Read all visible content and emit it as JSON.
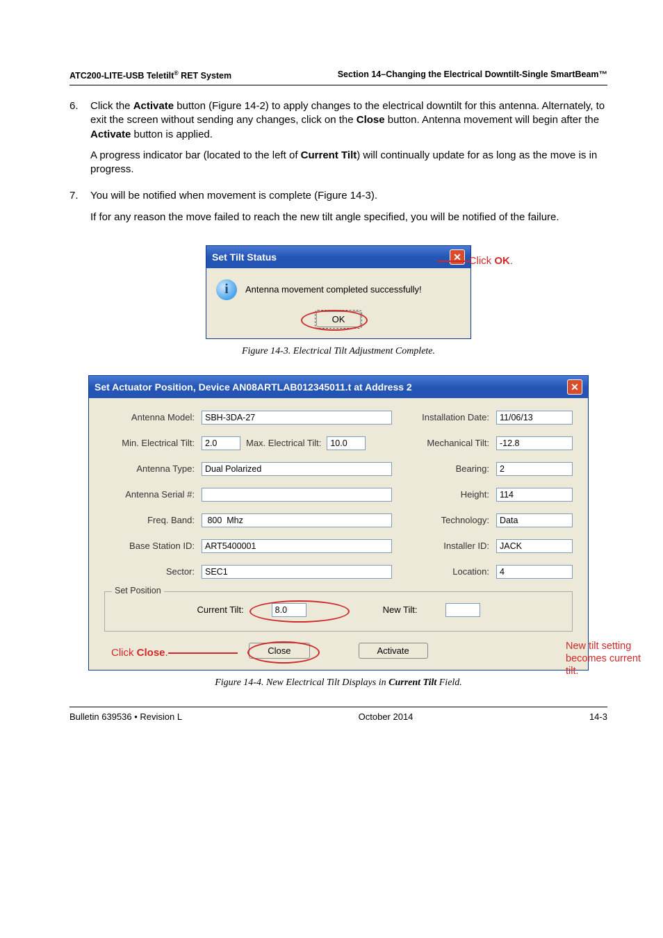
{
  "header": {
    "left": "ATC200-LITE-USB Teletilt® RET System",
    "right": "Section 14–Changing the Electrical Downtilt-Single SmartBeam™"
  },
  "steps": {
    "s6": {
      "num": "6.",
      "p1a": "Click the ",
      "p1b": "Activate",
      "p1c": " button (Figure 14-2) to apply changes to the electrical downtilt for this antenna. Alternately, to exit the screen without sending any changes, click on the ",
      "p1d": "Close",
      "p1e": " button. Antenna movement will begin after the ",
      "p1f": "Activate",
      "p1g": " button is applied.",
      "p2a": "A progress indicator bar (located to the left of ",
      "p2b": "Current Tilt",
      "p2c": ") will continually update for as long as the move is in progress."
    },
    "s7": {
      "num": "7.",
      "p1": "You will be notified when movement is complete (Figure 14-3).",
      "p2": "If for any reason the move failed to reach the new tilt angle specified, you will be notified of the failure."
    }
  },
  "dlg1": {
    "title": "Set Tilt Status",
    "msg": "Antenna movement completed successfully!",
    "ok": "OK",
    "click_ok_a": "Click ",
    "click_ok_b": "OK",
    "click_ok_c": "."
  },
  "caption1": "Figure 14-3. Electrical Tilt Adjustment Complete.",
  "dlg2": {
    "title": "Set Actuator Position, Device AN08ARTLAB012345011.t  at Address 2",
    "labels": {
      "model": "Antenna Model:",
      "install": "Installation Date:",
      "mintilt": "Min. Electrical Tilt:",
      "maxtilt": "Max. Electrical Tilt:",
      "mech": "Mechanical Tilt:",
      "type": "Antenna Type:",
      "bearing": "Bearing:",
      "serial": "Antenna Serial #:",
      "height": "Height:",
      "band": "Freq. Band:",
      "tech": "Technology:",
      "bsid": "Base Station ID:",
      "installer": "Installer ID:",
      "sector": "Sector:",
      "location": "Location:"
    },
    "vals": {
      "model": "SBH-3DA-27",
      "install": "11/06/13",
      "mintilt": "2.0",
      "maxtilt": "10.0",
      "mech": "-12.8",
      "type": "Dual Polarized",
      "bearing": "2",
      "serial": "",
      "height": "114",
      "band": " 800  Mhz",
      "tech": "Data",
      "bsid": "ART5400001",
      "installer": "JACK",
      "sector": "SEC1",
      "location": "4"
    },
    "legend": "Set Position",
    "curr_lbl": "Current Tilt:",
    "curr_val": "8.0",
    "new_lbl": "New Tilt:",
    "new_val": "",
    "close": "Close",
    "activate": "Activate",
    "click_close_a": "Click ",
    "click_close_b": "Close",
    "click_close_c": ".",
    "note": "New tilt setting becomes current tilt."
  },
  "caption2_a": "Figure 14-4. New Electrical Tilt Displays in ",
  "caption2_b": "Current Tilt",
  "caption2_c": " Field.",
  "footer": {
    "left": "Bulletin 639536  •  Revision L",
    "mid": "October 2014",
    "right": "14-3"
  }
}
